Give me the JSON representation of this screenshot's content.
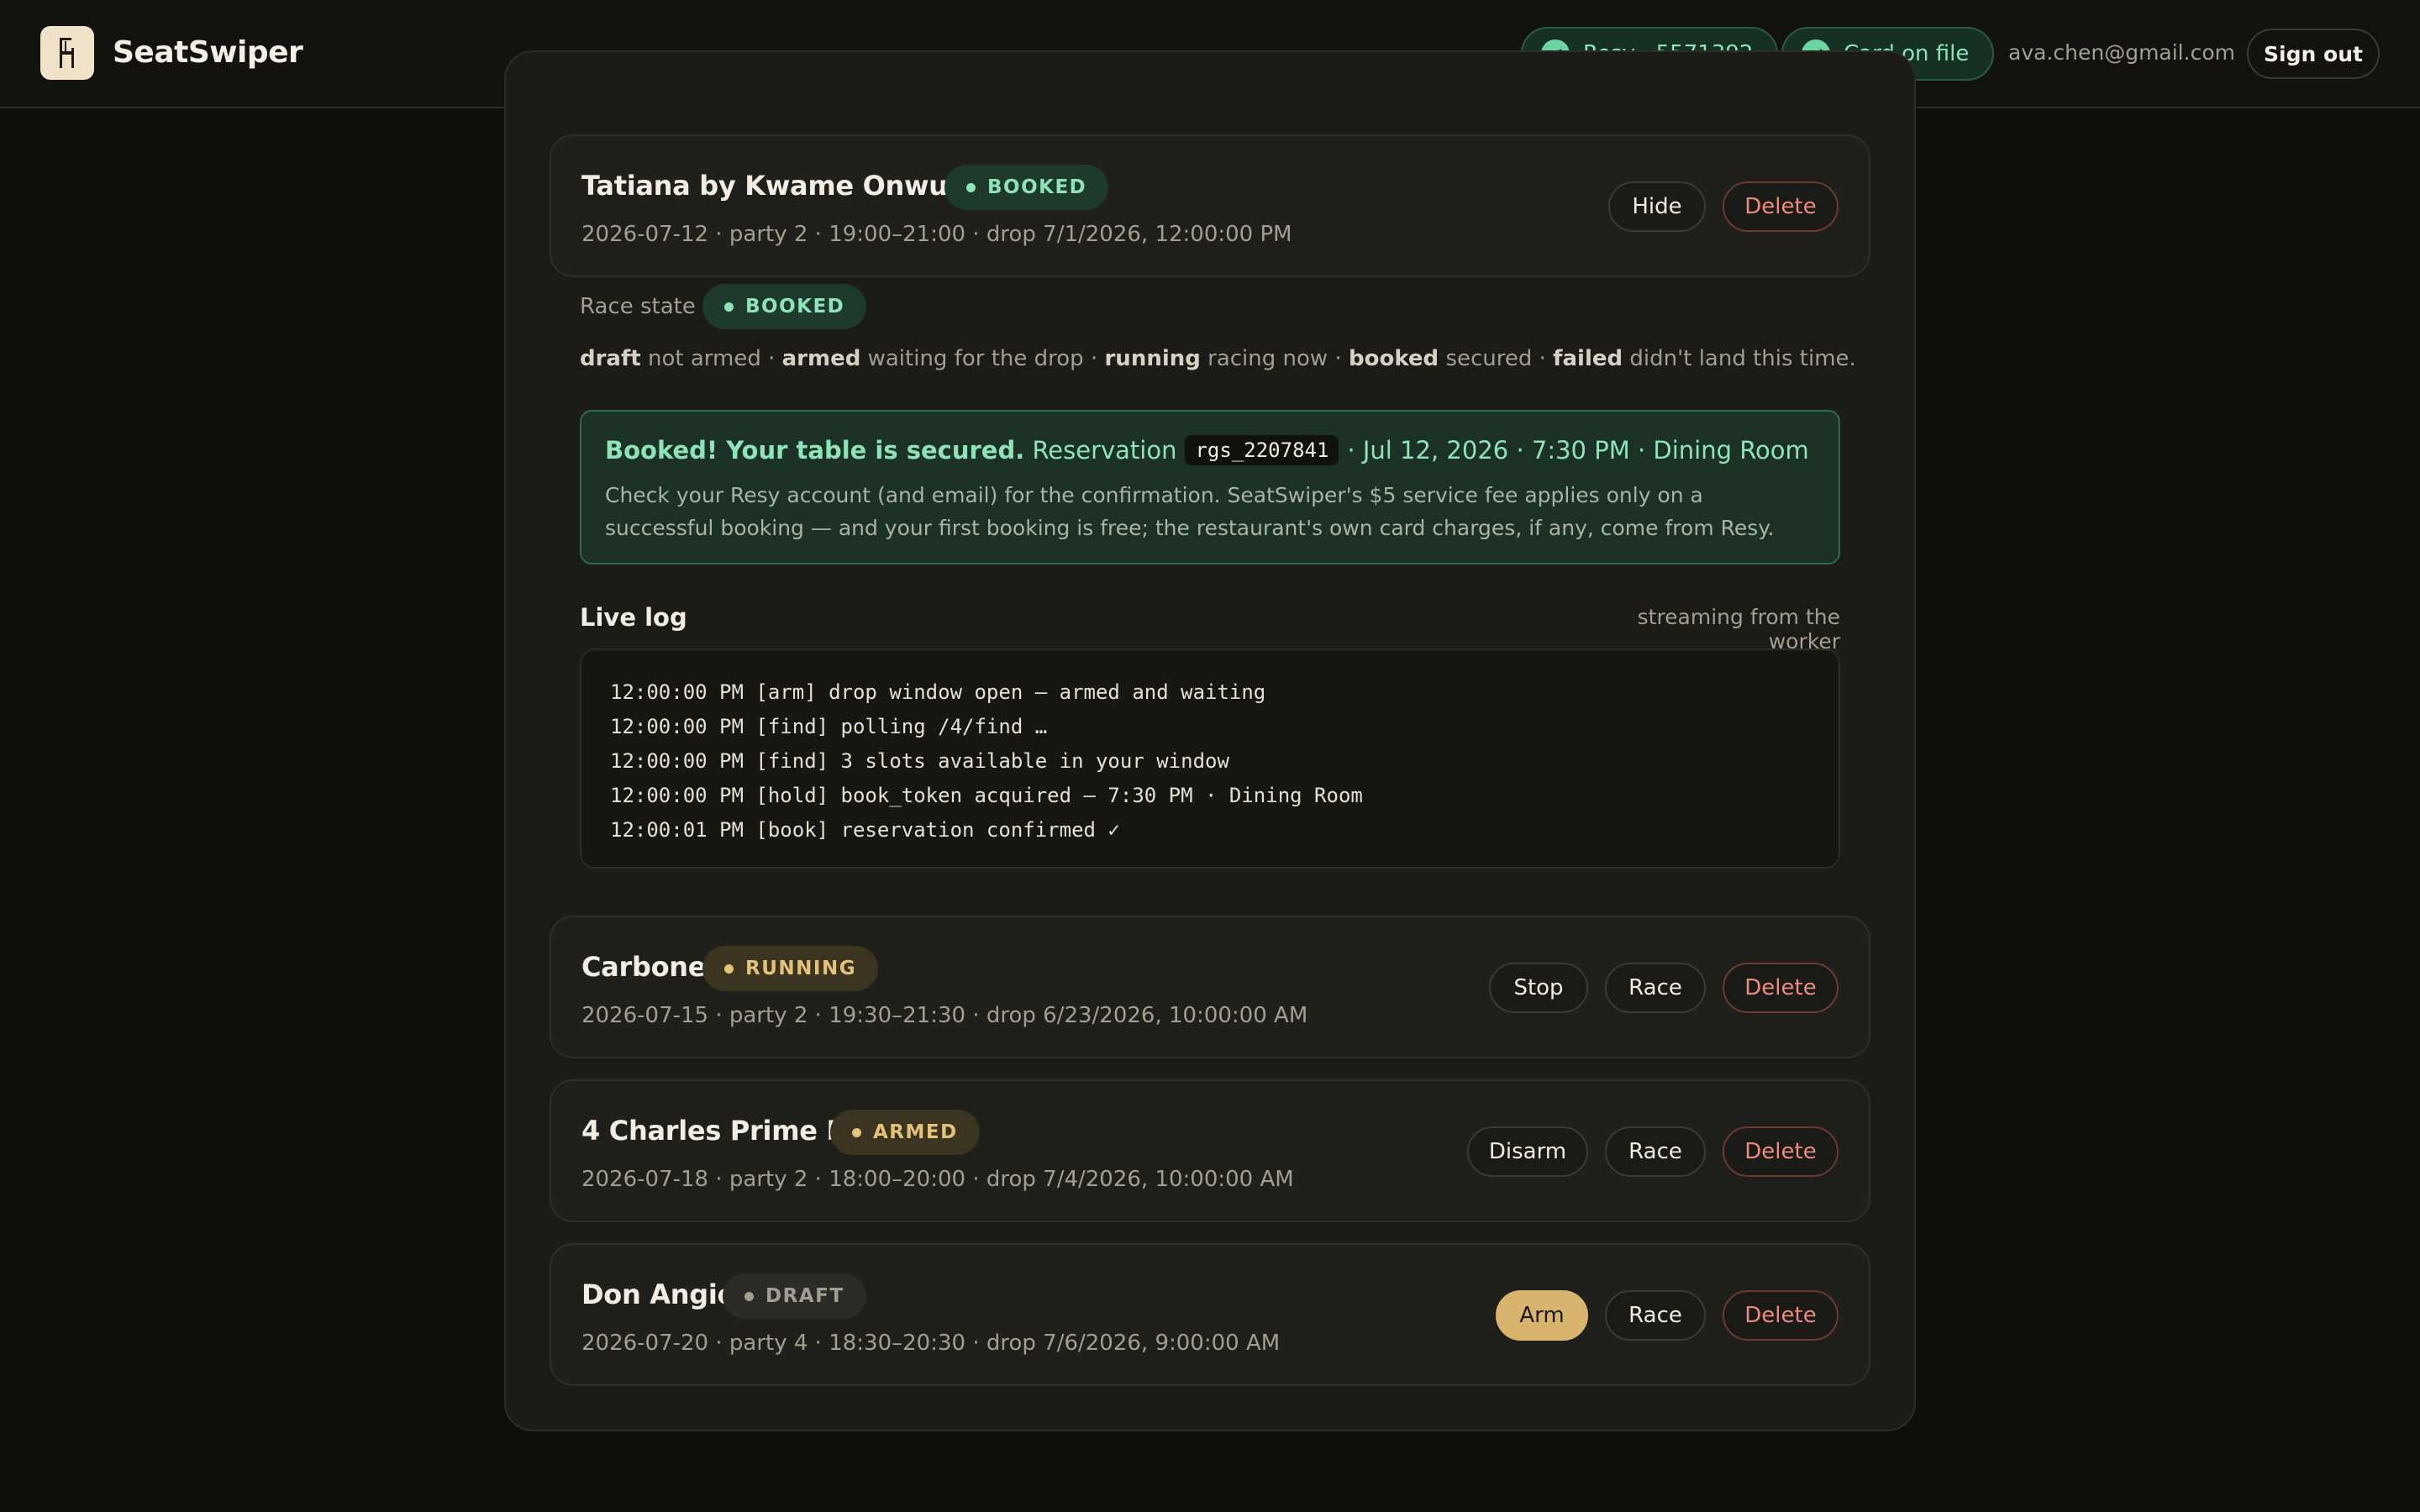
{
  "header": {
    "brand": "SeatSwiper",
    "resy_pill": "Resy · 5571392",
    "card_pill": "Card on file",
    "email": "ava.chen@gmail.com",
    "signout": "Sign out"
  },
  "colors": {
    "accent_green": "#8fe3b8",
    "accent_gold": "#d9b46e",
    "danger": "#ec8b7f",
    "background": "#0e0f0b"
  },
  "booked_card": {
    "title": "Tatiana by Kwame Onwuachi",
    "badge": "BOOKED",
    "meta": "2026-07-12 · party 2 · 19:00–21:00 · drop 7/1/2026, 12:00:00 PM",
    "hide": "Hide",
    "delete": "Delete"
  },
  "race": {
    "label": "Race state",
    "badge": "BOOKED",
    "legend": [
      {
        "term": "draft",
        "desc": "not armed"
      },
      {
        "term": "armed",
        "desc": "waiting for the drop"
      },
      {
        "term": "running",
        "desc": "racing now"
      },
      {
        "term": "booked",
        "desc": "secured"
      },
      {
        "term": "failed",
        "desc": "didn't land this time."
      }
    ]
  },
  "success": {
    "headline": "Booked! Your table is secured.",
    "reservation_label": "Reservation",
    "code": "rgs_2207841",
    "details": "· Jul 12, 2026 · 7:30 PM · Dining Room",
    "body": "Check your Resy account (and email) for the confirmation. SeatSwiper's $5 service fee applies only on a successful booking — and your first booking is free; the restaurant's own card charges, if any, come from Resy."
  },
  "log": {
    "title": "Live log",
    "side": "streaming from the worker",
    "lines": [
      "12:00:00 PM [arm] drop window open — armed and waiting",
      "12:00:00 PM [find] polling /4/find …",
      "12:00:00 PM [find] 3 slots available in your window",
      "12:00:00 PM [hold] book_token acquired — 7:30 PM · Dining Room",
      "12:00:01 PM [book] reservation confirmed ✓"
    ]
  },
  "reservations": [
    {
      "title": "Carbone",
      "badge": "RUNNING",
      "meta": "2026-07-15 · party 2 · 19:30–21:30 · drop 6/23/2026, 10:00:00 AM",
      "primary": "Stop",
      "race": "Race",
      "delete": "Delete"
    },
    {
      "title": "4 Charles Prime Rib",
      "badge": "ARMED",
      "meta": "2026-07-18 · party 2 · 18:00–20:00 · drop 7/4/2026, 10:00:00 AM",
      "primary": "Disarm",
      "race": "Race",
      "delete": "Delete"
    },
    {
      "title": "Don Angie",
      "badge": "DRAFT",
      "meta": "2026-07-20 · party 4 · 18:30–20:30 · drop 7/6/2026, 9:00:00 AM",
      "primary": "Arm",
      "race": "Race",
      "delete": "Delete"
    }
  ]
}
